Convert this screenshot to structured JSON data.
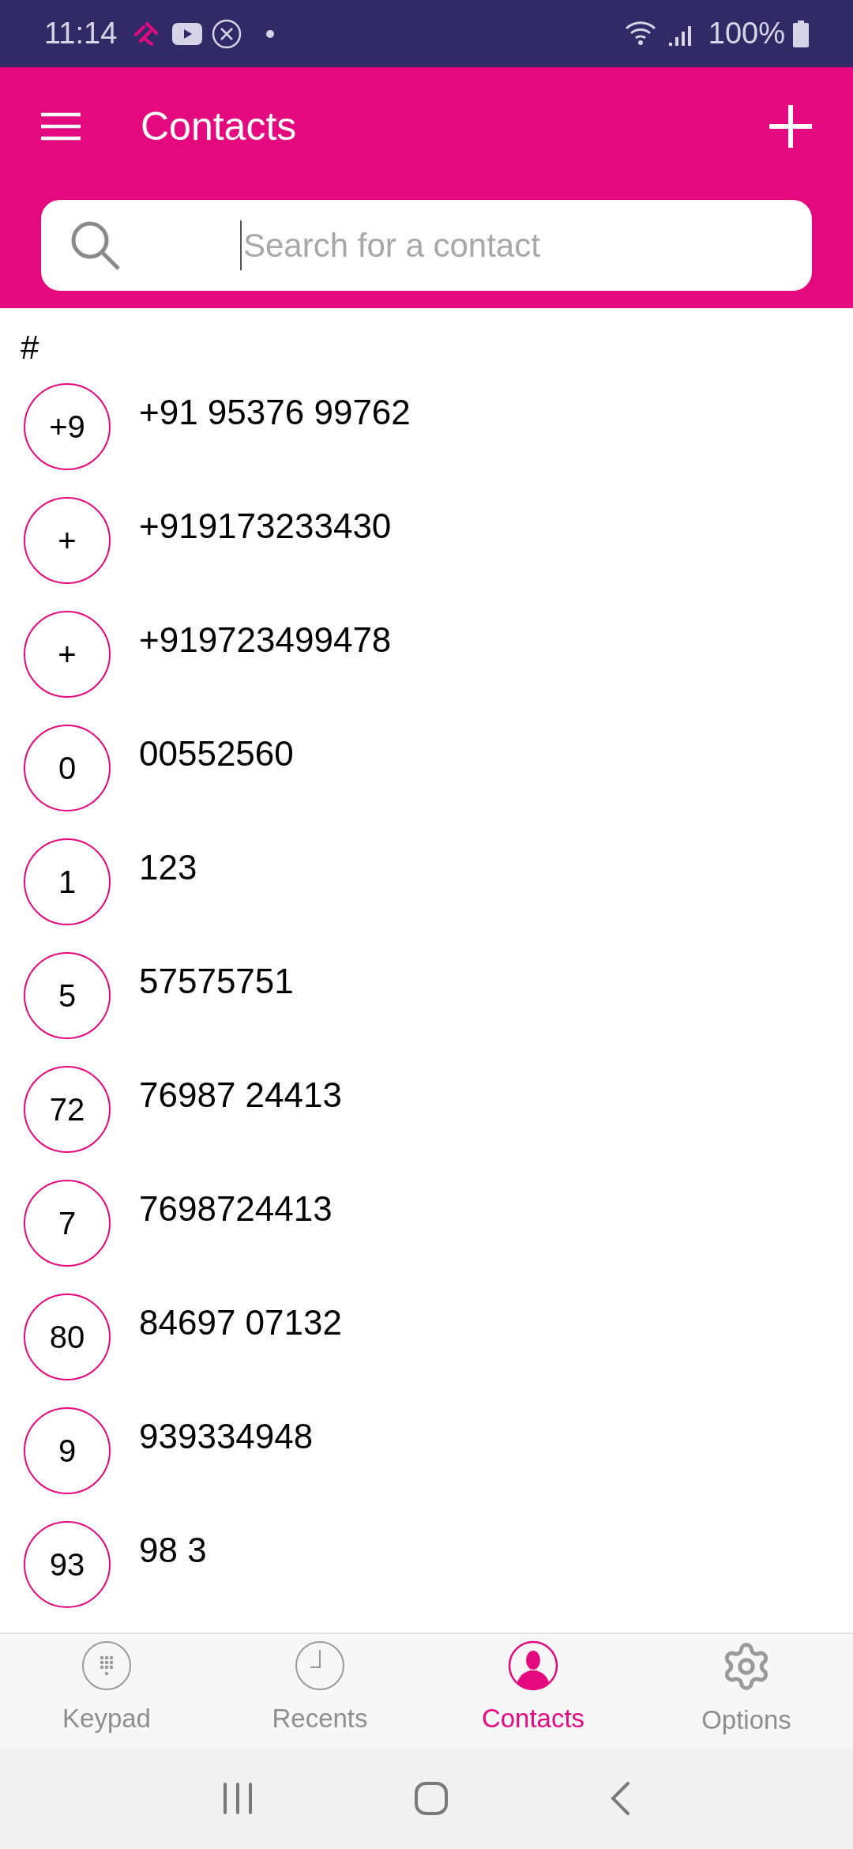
{
  "status_bar": {
    "time": "11:14",
    "battery": "100%"
  },
  "header": {
    "title": "Contacts"
  },
  "search": {
    "placeholder": "Search for a contact"
  },
  "section": {
    "heading": "#"
  },
  "contacts": [
    {
      "initials": "+9",
      "name": "+91 95376 99762"
    },
    {
      "initials": "+",
      "name": "+919173233430"
    },
    {
      "initials": "+",
      "name": "+919723499478"
    },
    {
      "initials": "0",
      "name": "00552560"
    },
    {
      "initials": "1",
      "name": "123"
    },
    {
      "initials": "5",
      "name": "57575751"
    },
    {
      "initials": "72",
      "name": "76987 24413"
    },
    {
      "initials": "7",
      "name": "7698724413"
    },
    {
      "initials": "80",
      "name": "84697 07132"
    },
    {
      "initials": "9",
      "name": "939334948"
    },
    {
      "initials": "93",
      "name": "98 3"
    }
  ],
  "tabs": [
    {
      "kind": "keypad",
      "label": "Keypad",
      "selected": false
    },
    {
      "kind": "recents",
      "label": "Recents",
      "selected": false
    },
    {
      "kind": "contacts",
      "label": "Contacts",
      "selected": true
    },
    {
      "kind": "options",
      "label": "Options",
      "selected": false
    }
  ]
}
